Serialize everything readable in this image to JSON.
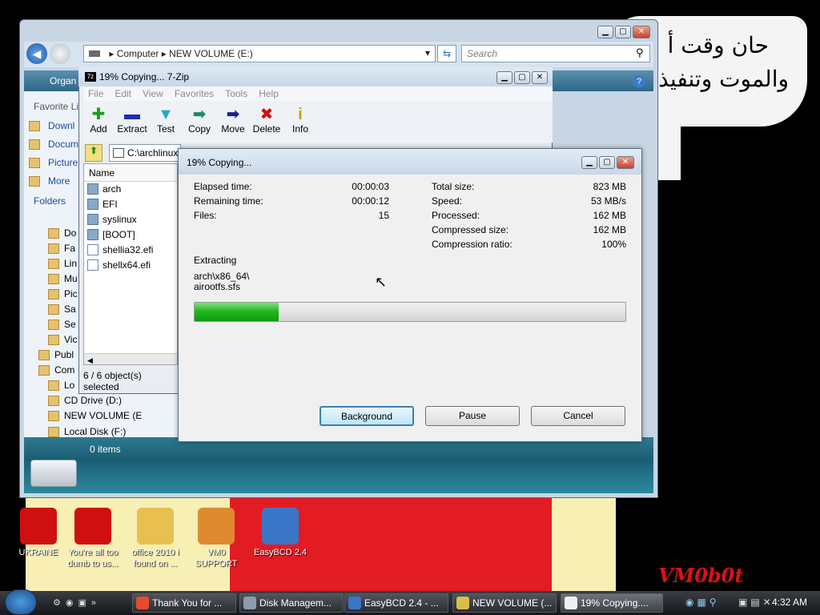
{
  "wallpaper": {
    "arabic_line1": "حان وقت أ",
    "arabic_line2": "والموت وتنفيذ",
    "signature": "VM0b0t"
  },
  "desktop_icons": [
    {
      "label": "UKRAINE",
      "icon": "radiation-icon"
    },
    {
      "label": "You're all too dumb to us...",
      "icon": "dev-cpp-icon"
    },
    {
      "label": "office 2010 i found on ...",
      "icon": "folder-icon"
    },
    {
      "label": "VM0 SUPPORT",
      "icon": "support-person-icon"
    },
    {
      "label": "EasyBCD 2.4",
      "icon": "easybcd-icon"
    }
  ],
  "explorer": {
    "breadcrumb": [
      "Computer",
      "NEW VOLUME (E:)"
    ],
    "search_placeholder": "Search",
    "organize_label": "Organ",
    "favorite_links_label": "Favorite Li",
    "favorites": [
      "Downl",
      "Docum",
      "Picture",
      "More"
    ],
    "folders_label": "Folders",
    "tree": [
      "Do",
      "Fa",
      "Lin",
      "Mu",
      "Pic",
      "Sa",
      "Se",
      "Vic",
      "Publ",
      "Com",
      "Lo",
      "CD Drive (D:)",
      "NEW VOLUME (E",
      "Local Disk (F:)"
    ],
    "items_count": "0 items"
  },
  "zip": {
    "title": "19% Copying... 7-Zip",
    "menu": [
      "File",
      "Edit",
      "View",
      "Favorites",
      "Tools",
      "Help"
    ],
    "tools": [
      {
        "label": "Add",
        "glyph": "✚",
        "color": "#1aa01a"
      },
      {
        "label": "Extract",
        "glyph": "▬",
        "color": "#1c2fb0"
      },
      {
        "label": "Test",
        "glyph": "▼",
        "color": "#2aa6c8"
      },
      {
        "label": "Copy",
        "glyph": "➡",
        "color": "#1f8a6a"
      },
      {
        "label": "Move",
        "glyph": "➡",
        "color": "#1c2090"
      },
      {
        "label": "Delete",
        "glyph": "✖",
        "color": "#d01010"
      },
      {
        "label": "Info",
        "glyph": "i",
        "color": "#c8a000"
      }
    ],
    "path": "C:\\archlinux",
    "column_name": "Name",
    "files": [
      {
        "name": "arch",
        "type": "folder"
      },
      {
        "name": "EFI",
        "type": "folder"
      },
      {
        "name": "syslinux",
        "type": "folder"
      },
      {
        "name": "[BOOT]",
        "type": "folder"
      },
      {
        "name": "shellia32.efi",
        "type": "file"
      },
      {
        "name": "shellx64.efi",
        "type": "file"
      }
    ],
    "status": "6 / 6 object(s) selected"
  },
  "dialog": {
    "title": "19% Copying...",
    "left": [
      {
        "label": "Elapsed time:",
        "value": "00:00:03"
      },
      {
        "label": "Remaining time:",
        "value": "00:00:12"
      },
      {
        "label": "Files:",
        "value": "15"
      }
    ],
    "right": [
      {
        "label": "Total size:",
        "value": "823 MB"
      },
      {
        "label": "Speed:",
        "value": "53 MB/s"
      },
      {
        "label": "Processed:",
        "value": "162 MB"
      },
      {
        "label": "Compressed size:",
        "value": "162 MB"
      },
      {
        "label": "Compression ratio:",
        "value": "100%"
      }
    ],
    "action": "Extracting",
    "current_path": "arch\\x86_64\\",
    "current_file": "airootfs.sfs",
    "progress_fraction": 0.195,
    "buttons": {
      "background": "Background",
      "pause": "Pause",
      "cancel": "Cancel"
    }
  },
  "taskbar": {
    "buttons": [
      {
        "label": "Thank You for ...",
        "color": "#e84a2c"
      },
      {
        "label": "Disk Managem...",
        "color": "#8a9cb0"
      },
      {
        "label": "EasyBCD 2.4 - ...",
        "color": "#3a76c8"
      },
      {
        "label": "NEW VOLUME (...",
        "color": "#d8c048"
      },
      {
        "label": "19% Copying....",
        "color": "#f0f0f0"
      }
    ],
    "clock": "4:32 AM"
  },
  "colors": {
    "progress": "#1fb51c",
    "titlebar": "#c8d7e8"
  }
}
